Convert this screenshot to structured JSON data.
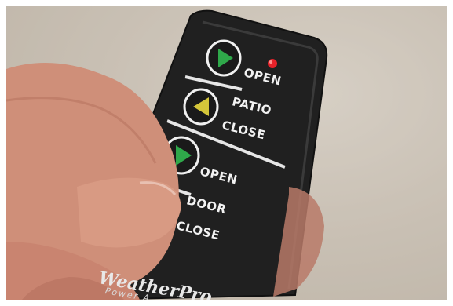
{
  "remote": {
    "patio_group": {
      "open_label": "OPEN",
      "group_label": "PATIO",
      "close_label": "CLOSE"
    },
    "door_group": {
      "open_label": "OPEN",
      "group_label": "DOOR",
      "close_label": "CLOSE"
    },
    "brand": "WeatherPro",
    "tagline": "Power A"
  },
  "colors": {
    "remote_body": "#1f1f1f",
    "open_arrow": "#2fa84a",
    "close_arrow": "#d4c63a",
    "indicator_led": "#e8222a",
    "label_text": "#f2f2f2"
  }
}
